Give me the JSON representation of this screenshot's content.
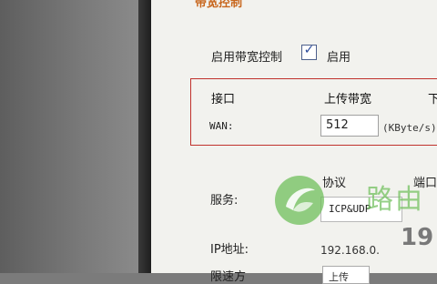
{
  "section": {
    "title": "带宽控制"
  },
  "enable": {
    "label": "启用带宽控制",
    "checked": true,
    "checkbox_label": "启用"
  },
  "table": {
    "col_interface": "接口",
    "col_upload": "上传带宽",
    "col_download_partial": "下",
    "row": {
      "interface": "WAN:",
      "upload": "512",
      "unit": "(KByte/s)"
    }
  },
  "rules": {
    "protocol_header": "协议",
    "port_header": "端口",
    "service_label": "服务:",
    "service_value": "ICP&UDP",
    "ip_label": "IP地址:",
    "ip_value": "192.168.0.",
    "next_label": "限速方",
    "next_value": "上传"
  },
  "watermark": {
    "text": "路由",
    "number": "19",
    "colors": {
      "green": "#6fbf5b",
      "grey": "#5c5c5c"
    }
  }
}
